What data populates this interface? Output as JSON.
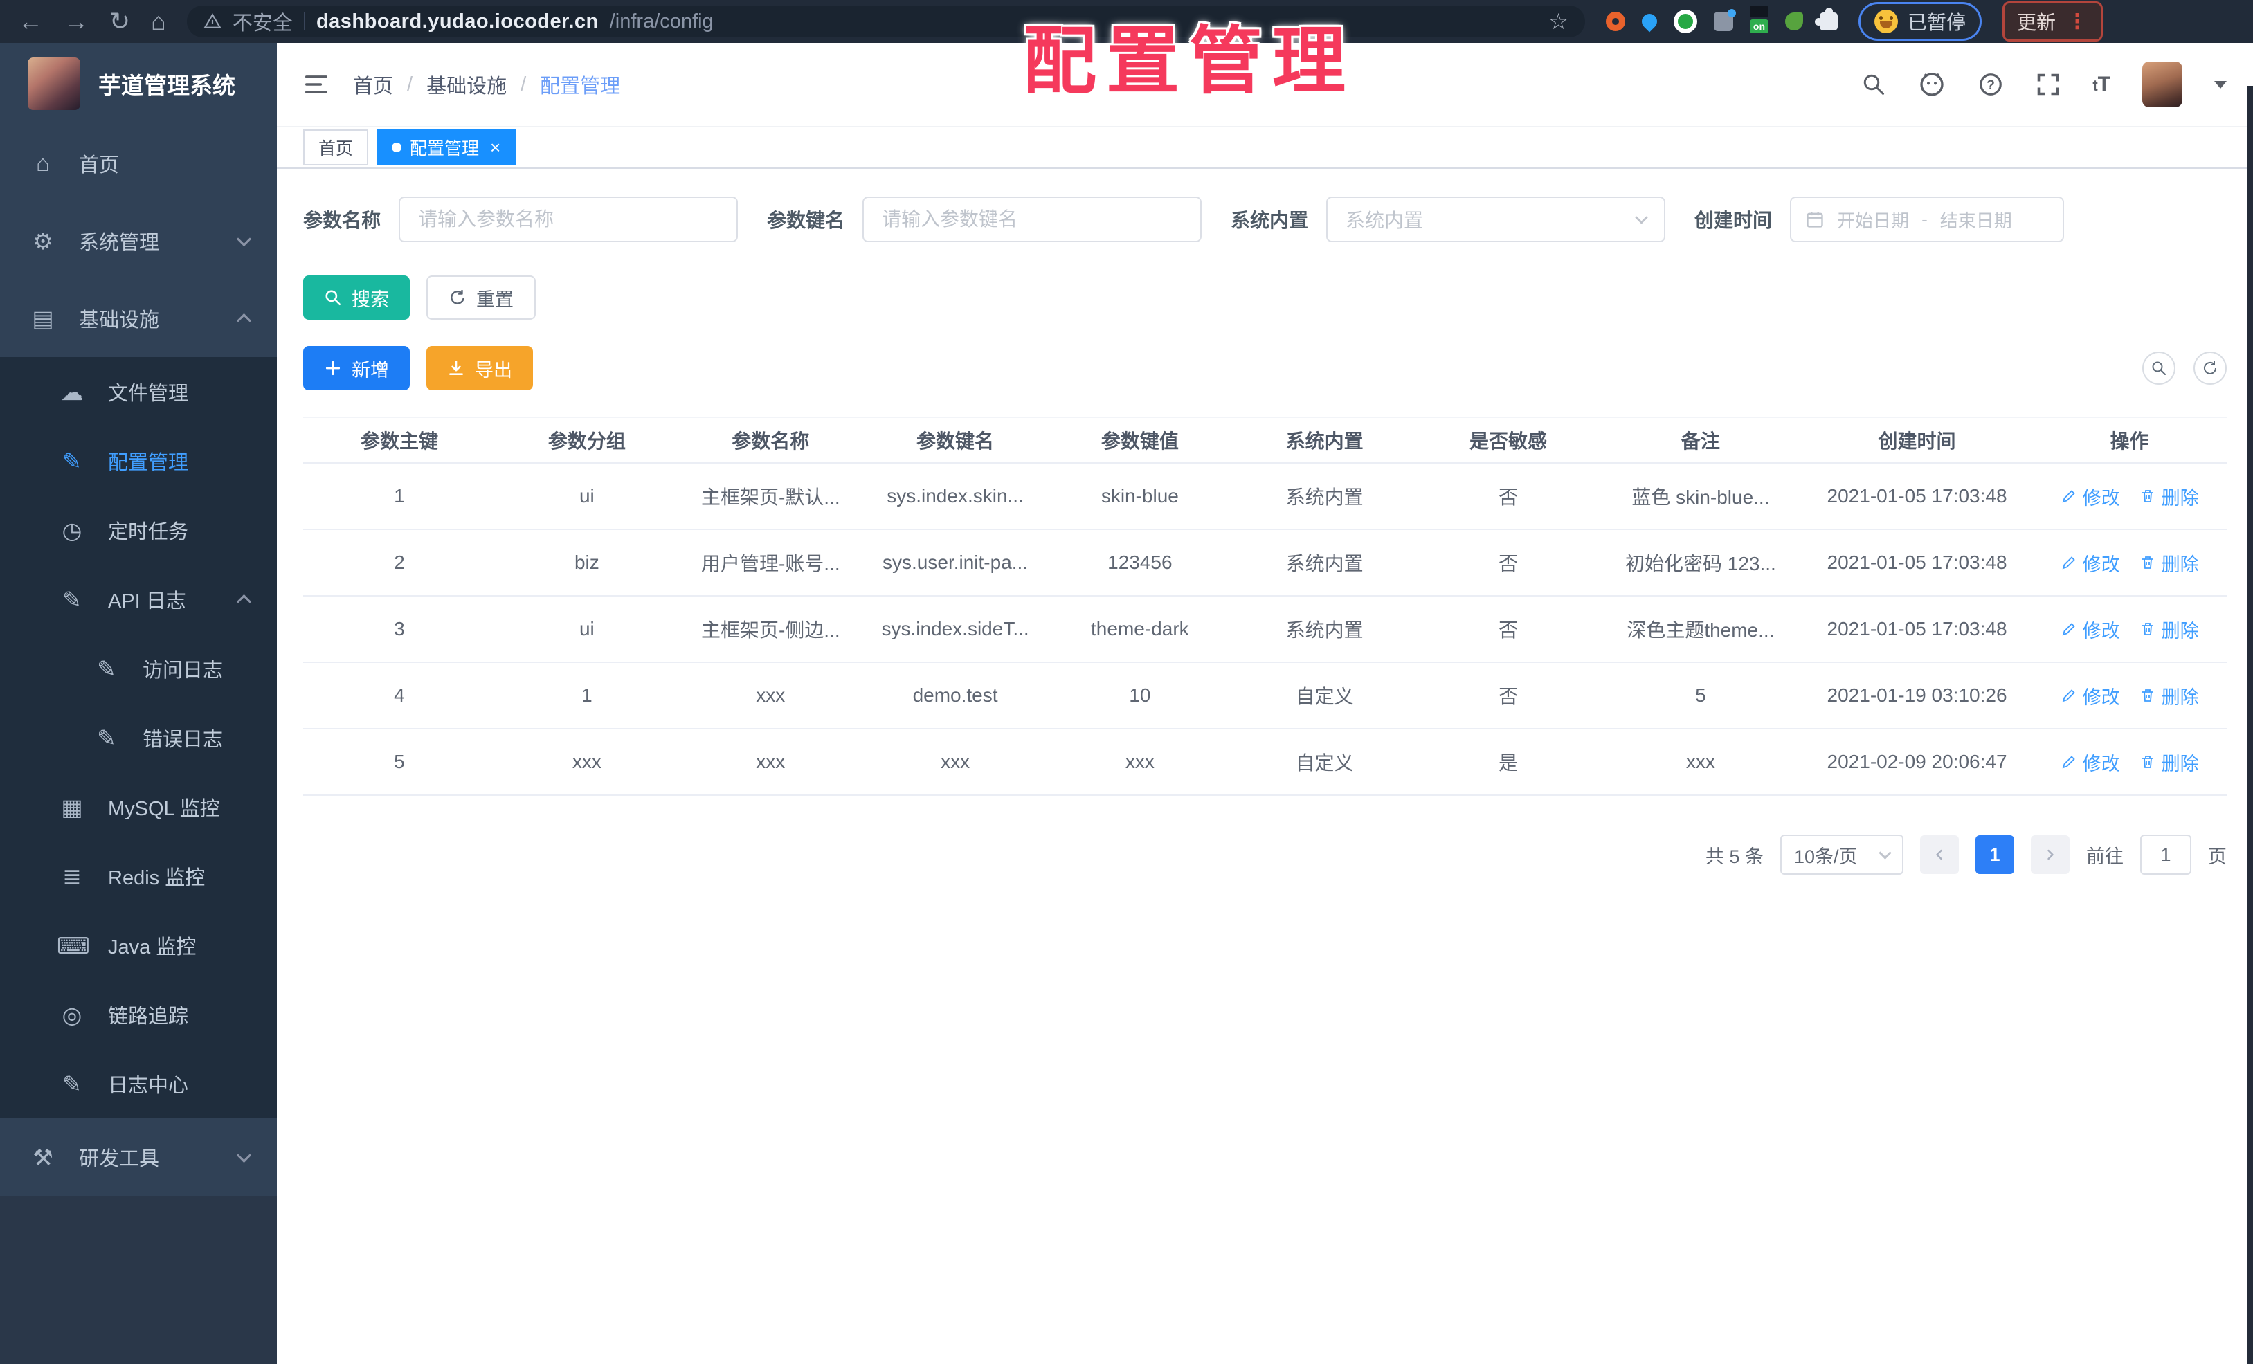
{
  "browser": {
    "security_label": "不安全",
    "url_domain": "dashboard.yudao.iocoder.cn",
    "url_path": "/infra/config",
    "paused_badge": "已暂停",
    "update_label": "更新"
  },
  "overlay_title": "配置管理",
  "sidebar": {
    "app_title": "芋道管理系统",
    "menu": [
      {
        "id": "home",
        "label": "首页",
        "icon": "home-icon",
        "level": 1
      },
      {
        "id": "system",
        "label": "系统管理",
        "icon": "gear-icon",
        "level": 1,
        "chevron": "down"
      },
      {
        "id": "infra",
        "label": "基础设施",
        "icon": "grid-icon",
        "level": 1,
        "chevron": "up"
      },
      {
        "id": "file",
        "label": "文件管理",
        "icon": "cloud-icon",
        "level": 2
      },
      {
        "id": "config",
        "label": "配置管理",
        "icon": "edit-icon",
        "level": 2,
        "active": true
      },
      {
        "id": "job",
        "label": "定时任务",
        "icon": "clock-icon",
        "level": 2
      },
      {
        "id": "api-log",
        "label": "API 日志",
        "icon": "edit-icon",
        "level": 2,
        "chevron": "up"
      },
      {
        "id": "access-log",
        "label": "访问日志",
        "icon": "edit-icon",
        "level": 3
      },
      {
        "id": "error-log",
        "label": "错误日志",
        "icon": "edit-icon",
        "level": 3
      },
      {
        "id": "mysql",
        "label": "MySQL 监控",
        "icon": "table-icon",
        "level": 2
      },
      {
        "id": "redis",
        "label": "Redis 监控",
        "icon": "stack-icon",
        "level": 2
      },
      {
        "id": "java",
        "label": "Java 监控",
        "icon": "keyboard-icon",
        "level": 2
      },
      {
        "id": "trace",
        "label": "链路追踪",
        "icon": "eye-icon",
        "level": 2
      },
      {
        "id": "log-center",
        "label": "日志中心",
        "icon": "edit-icon",
        "level": 2
      },
      {
        "id": "dev-tools",
        "label": "研发工具",
        "icon": "tools-icon",
        "level": 1,
        "chevron": "down"
      }
    ]
  },
  "header": {
    "breadcrumb": [
      "首页",
      "基础设施",
      "配置管理"
    ]
  },
  "tabs": [
    {
      "label": "首页",
      "active": false
    },
    {
      "label": "配置管理",
      "active": true,
      "closable": true
    }
  ],
  "filters": {
    "name": {
      "label": "参数名称",
      "placeholder": "请输入参数名称"
    },
    "key": {
      "label": "参数键名",
      "placeholder": "请输入参数键名"
    },
    "builtin": {
      "label": "系统内置",
      "placeholder": "系统内置"
    },
    "time": {
      "label": "创建时间",
      "start_placeholder": "开始日期",
      "separator": "-",
      "end_placeholder": "结束日期"
    }
  },
  "toolbar": {
    "search_label": "搜索",
    "reset_label": "重置",
    "add_label": "新增",
    "export_label": "导出"
  },
  "table": {
    "columns": [
      "参数主键",
      "参数分组",
      "参数名称",
      "参数键名",
      "参数键值",
      "系统内置",
      "是否敏感",
      "备注",
      "创建时间",
      "操作"
    ],
    "op_edit": "修改",
    "op_delete": "删除",
    "rows": [
      [
        "1",
        "ui",
        "主框架页-默认...",
        "sys.index.skin...",
        "skin-blue",
        "系统内置",
        "否",
        "蓝色 skin-blue...",
        "2021-01-05 17:03:48"
      ],
      [
        "2",
        "biz",
        "用户管理-账号...",
        "sys.user.init-pa...",
        "123456",
        "系统内置",
        "否",
        "初始化密码 123...",
        "2021-01-05 17:03:48"
      ],
      [
        "3",
        "ui",
        "主框架页-侧边...",
        "sys.index.sideT...",
        "theme-dark",
        "系统内置",
        "否",
        "深色主题theme...",
        "2021-01-05 17:03:48"
      ],
      [
        "4",
        "1",
        "xxx",
        "demo.test",
        "10",
        "自定义",
        "否",
        "5",
        "2021-01-19 03:10:26"
      ],
      [
        "5",
        "xxx",
        "xxx",
        "xxx",
        "xxx",
        "自定义",
        "是",
        "xxx",
        "2021-02-09 20:06:47"
      ]
    ]
  },
  "pagination": {
    "total": "共 5 条",
    "page_size": "10条/页",
    "current": "1",
    "goto_label": "前往",
    "goto_value": "1",
    "unit": "页"
  },
  "colors": {
    "accent": "#409eff",
    "active_tab": "#1890ff",
    "search_btn": "#19b89f",
    "add_btn": "#1d7df5",
    "export_btn": "#f6a42a",
    "overlay": "#f5395c",
    "sidebar": "#304156",
    "submenu": "#1f2d3d",
    "browser_bar": "#212b39"
  }
}
